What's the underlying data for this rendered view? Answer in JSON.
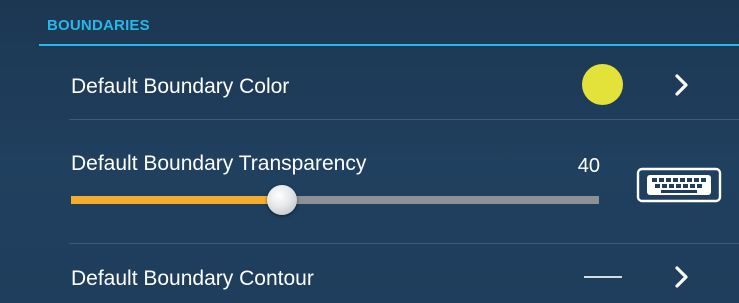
{
  "section": {
    "title": "BOUNDARIES"
  },
  "rows": {
    "color": {
      "label": "Default Boundary Color",
      "swatch_color": "#e2e23a",
      "action_icon": "chevron-right-icon"
    },
    "transparency": {
      "label": "Default Boundary Transparency",
      "value": "40",
      "slider_fraction": 0.4,
      "fill_color": "#f6ad2c",
      "keyboard_icon": "keyboard-icon"
    },
    "contour": {
      "label": "Default Boundary Contour",
      "line_style": "solid",
      "action_icon": "chevron-right-icon"
    }
  },
  "colors": {
    "accent": "#29b6e8",
    "background": "#1e3a58"
  }
}
